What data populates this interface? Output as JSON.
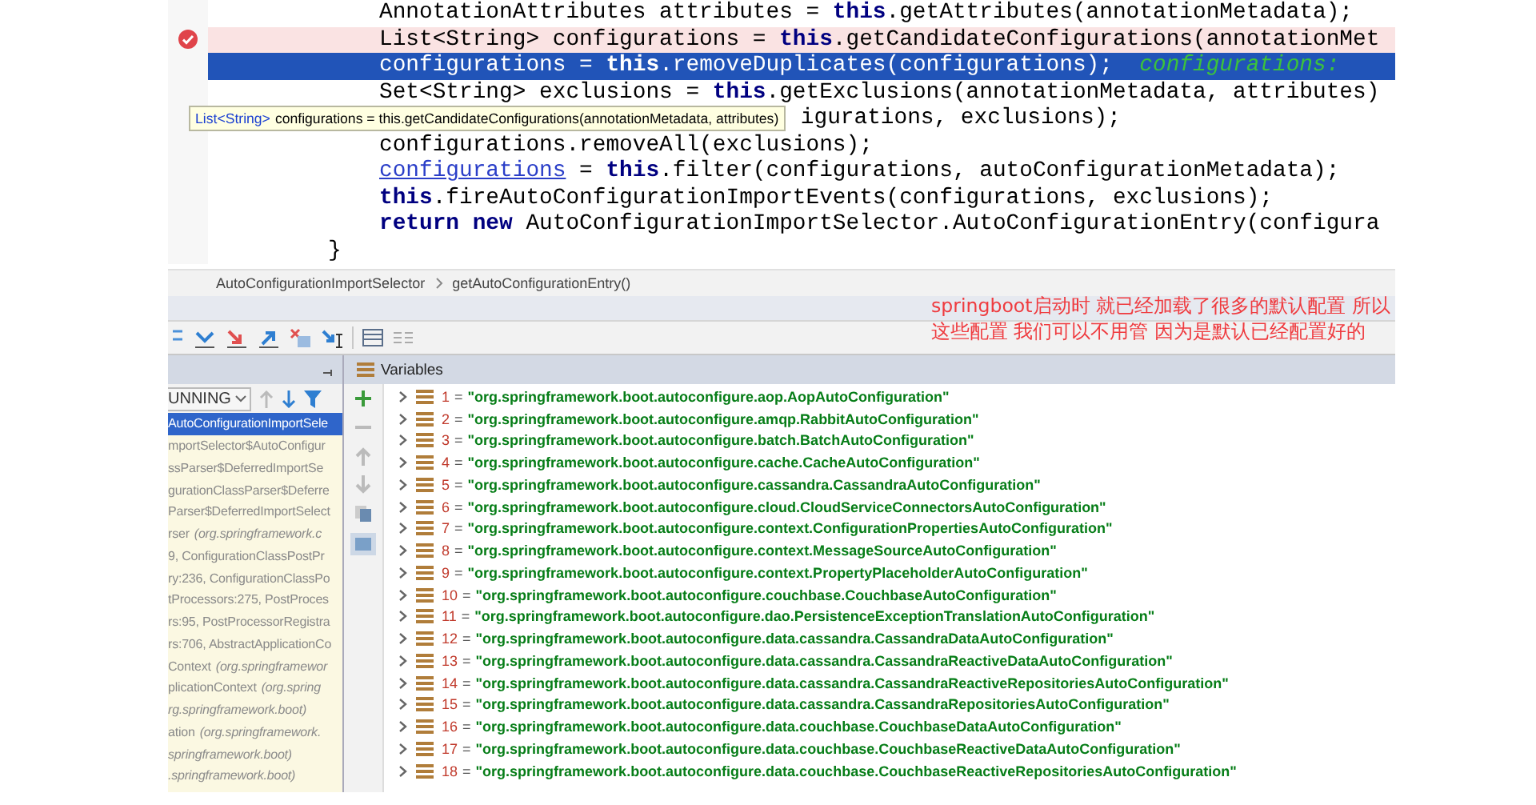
{
  "editor": {
    "lines": [
      {
        "kind": "normal",
        "segments": [
          {
            "kind": "plain",
            "text": "AnnotationAttributes attributes = "
          },
          {
            "kind": "keyword",
            "text": "this"
          },
          {
            "kind": "plain",
            "text": ".getAttributes(annotationMetadata);"
          }
        ]
      },
      {
        "kind": "breakpoint",
        "segments": [
          {
            "kind": "plain",
            "text": "List<String> configurations = "
          },
          {
            "kind": "keyword",
            "text": "this"
          },
          {
            "kind": "plain",
            "text": ".getCandidateConfigurations(annotationMet"
          }
        ]
      },
      {
        "kind": "execution",
        "segments": [
          {
            "kind": "plain",
            "text": "configurations = "
          },
          {
            "kind": "keyword",
            "text": "this"
          },
          {
            "kind": "plain",
            "text": ".removeDuplicates(configurations);"
          }
        ],
        "debug_value": "configurations:"
      },
      {
        "kind": "normal",
        "segments": [
          {
            "kind": "plain",
            "text": "Set<String> exclusions = "
          },
          {
            "kind": "keyword",
            "text": "this"
          },
          {
            "kind": "plain",
            "text": ".getExclusions(annotationMetadata, attributes)"
          }
        ]
      },
      {
        "kind": "covered",
        "segments": [
          {
            "kind": "plain",
            "text": "igurations, exclusions);"
          }
        ]
      },
      {
        "kind": "normal",
        "segments": [
          {
            "kind": "plain",
            "text": "configurations.removeAll(exclusions);"
          }
        ]
      },
      {
        "kind": "normal",
        "segments": [
          {
            "kind": "field",
            "text": "configurations"
          },
          {
            "kind": "plain",
            "text": " = "
          },
          {
            "kind": "keyword",
            "text": "this"
          },
          {
            "kind": "plain",
            "text": ".filter(configurations, autoConfigurationMetadata);"
          }
        ]
      },
      {
        "kind": "normal",
        "segments": [
          {
            "kind": "keyword",
            "text": "this"
          },
          {
            "kind": "plain",
            "text": ".fireAutoConfigurationImportEvents(configurations, exclusions);"
          }
        ]
      },
      {
        "kind": "normal",
        "segments": [
          {
            "kind": "keyword",
            "text": "return"
          },
          {
            "kind": "keyword",
            "text": "new"
          },
          {
            "kind": "plain",
            "text": " AutoConfigurationImportSelector.AutoConfigurationEntry(configura"
          }
        ]
      }
    ],
    "closing_brace": "}",
    "tooltip": {
      "type": "List<String>",
      "text": "configurations = this.getCandidateConfigurations(annotationMetadata, attributes)"
    }
  },
  "breadcrumb": [
    "AutoConfigurationImportSelector",
    "getAutoConfigurationEntry()"
  ],
  "annotation": "springboot启动时 就已经加载了很多的默认配置 所以这些配置 我们可以不用管 因为是默认已经配置好的",
  "frames_panel": {
    "thread": "UNNING",
    "frames": [
      {
        "method": "AutoConfigurationImportSele",
        "selected": true
      },
      {
        "method": "mportSelector$AutoConfigur",
        "selected": false
      },
      {
        "method": "ssParser$DeferredImportSe",
        "selected": false
      },
      {
        "method": "gurationClassParser$Deferre",
        "selected": false
      },
      {
        "method": "Parser$DeferredImportSelect",
        "selected": false
      },
      {
        "method": "rser",
        "location": "(org.springframework.c",
        "selected": false
      },
      {
        "method": "9, ConfigurationClassPostPr",
        "selected": false
      },
      {
        "method": "ry:236, ConfigurationClassPo",
        "selected": false
      },
      {
        "method": "tProcessors:275, PostProces",
        "selected": false
      },
      {
        "method": "rs:95, PostProcessorRegistra",
        "selected": false
      },
      {
        "method": "rs:706, AbstractApplicationCo",
        "selected": false
      },
      {
        "method": "Context",
        "location": "(org.springframewor",
        "selected": false
      },
      {
        "method": "plicationContext",
        "location": "(org.spring",
        "selected": false
      },
      {
        "location": "rg.springframework.boot)",
        "selected": false
      },
      {
        "method": "ation",
        "location": "(org.springframework.",
        "selected": false
      },
      {
        "location": "springframework.boot)",
        "selected": false
      },
      {
        "location": ".springframework.boot)",
        "selected": false
      }
    ]
  },
  "variables_panel": {
    "title": "Variables",
    "items": [
      {
        "name": "1",
        "operator": "=",
        "value": "\"org.springframework.boot.autoconfigure.aop.AopAutoConfiguration\"",
        "expanded": false
      },
      {
        "name": "2",
        "operator": "=",
        "value": "\"org.springframework.boot.autoconfigure.amqp.RabbitAutoConfiguration\"",
        "expanded": false
      },
      {
        "name": "3",
        "operator": "=",
        "value": "\"org.springframework.boot.autoconfigure.batch.BatchAutoConfiguration\"",
        "expanded": false
      },
      {
        "name": "4",
        "operator": "=",
        "value": "\"org.springframework.boot.autoconfigure.cache.CacheAutoConfiguration\"",
        "expanded": false
      },
      {
        "name": "5",
        "operator": "=",
        "value": "\"org.springframework.boot.autoconfigure.cassandra.CassandraAutoConfiguration\"",
        "expanded": false
      },
      {
        "name": "6",
        "operator": "=",
        "value": "\"org.springframework.boot.autoconfigure.cloud.CloudServiceConnectorsAutoConfiguration\"",
        "expanded": false
      },
      {
        "name": "7",
        "operator": "=",
        "value": "\"org.springframework.boot.autoconfigure.context.ConfigurationPropertiesAutoConfiguration\"",
        "expanded": false
      },
      {
        "name": "8",
        "operator": "=",
        "value": "\"org.springframework.boot.autoconfigure.context.MessageSourceAutoConfiguration\"",
        "expanded": false
      },
      {
        "name": "9",
        "operator": "=",
        "value": "\"org.springframework.boot.autoconfigure.context.PropertyPlaceholderAutoConfiguration\"",
        "expanded": false
      },
      {
        "name": "10",
        "operator": "=",
        "value": "\"org.springframework.boot.autoconfigure.couchbase.CouchbaseAutoConfiguration\"",
        "expanded": false
      },
      {
        "name": "11",
        "operator": "=",
        "value": "\"org.springframework.boot.autoconfigure.dao.PersistenceExceptionTranslationAutoConfiguration\"",
        "expanded": false
      },
      {
        "name": "12",
        "operator": "=",
        "value": "\"org.springframework.boot.autoconfigure.data.cassandra.CassandraDataAutoConfiguration\"",
        "expanded": false
      },
      {
        "name": "13",
        "operator": "=",
        "value": "\"org.springframework.boot.autoconfigure.data.cassandra.CassandraReactiveDataAutoConfiguration\"",
        "expanded": false
      },
      {
        "name": "14",
        "operator": "=",
        "value": "\"org.springframework.boot.autoconfigure.data.cassandra.CassandraReactiveRepositoriesAutoConfiguration\"",
        "expanded": false
      },
      {
        "name": "15",
        "operator": "=",
        "value": "\"org.springframework.boot.autoconfigure.data.cassandra.CassandraRepositoriesAutoConfiguration\"",
        "expanded": false
      },
      {
        "name": "16",
        "operator": "=",
        "value": "\"org.springframework.boot.autoconfigure.data.couchbase.CouchbaseDataAutoConfiguration\"",
        "expanded": false
      },
      {
        "name": "17",
        "operator": "=",
        "value": "\"org.springframework.boot.autoconfigure.data.couchbase.CouchbaseReactiveDataAutoConfiguration\"",
        "expanded": false
      },
      {
        "name": "18",
        "operator": "=",
        "value": "\"org.springframework.boot.autoconfigure.data.couchbase.CouchbaseReactiveRepositoriesAutoConfiguration\"",
        "expanded": false
      }
    ]
  }
}
